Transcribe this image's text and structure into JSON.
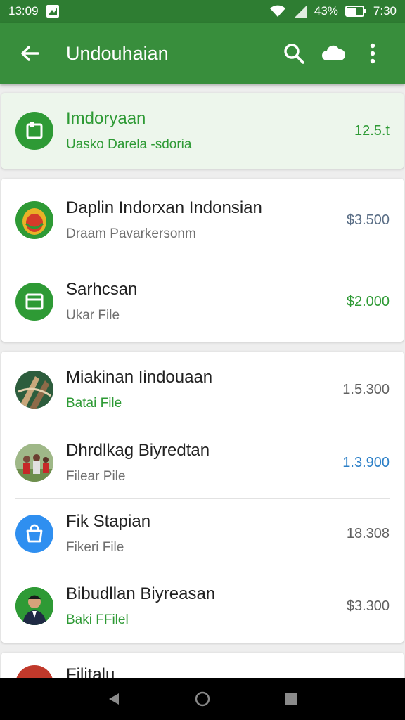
{
  "status": {
    "time_left": "13:09",
    "battery": "43%",
    "time_right": "7:30",
    "icons": [
      "image-icon",
      "wifi-icon",
      "signal-icon",
      "battery-icon"
    ]
  },
  "appbar": {
    "title": "Undouhaian",
    "icons": [
      "back-arrow-icon",
      "search-icon",
      "cloud-icon",
      "more-vert-icon"
    ]
  },
  "featured": {
    "name": "Imdoryaan",
    "subtitle": "Uasko Darela  -sdoria",
    "amount": "12.5.t",
    "icon": "document-icon"
  },
  "group1": [
    {
      "name": "Daplin Indorxan Indonsian",
      "subtitle": "Draam Pavarkersonm",
      "amount": "$3.500",
      "icon": "flag-emblem-icon"
    },
    {
      "name": "Sarhcsan",
      "subtitle": "Ukar File",
      "amount": "$2.000",
      "icon": "window-icon"
    }
  ],
  "group2": [
    {
      "name": "Miakinan Iindouaan",
      "subtitle": "Batai File",
      "amount": "1.5.300",
      "icon": "artwork-thumbnail"
    },
    {
      "name": "Dhrdlkag Biyredtan",
      "subtitle": "Filear Pile",
      "amount": "1.3.900",
      "icon": "people-photo-thumbnail"
    },
    {
      "name": "Fik Stapian",
      "subtitle": "Fikeri File",
      "amount": "18.308",
      "icon": "shopping-bag-icon"
    },
    {
      "name": "Bibudllan Biyreasan",
      "subtitle": "Baki FFilel",
      "amount": "$3.300",
      "icon": "person-portrait-thumbnail"
    }
  ],
  "partial": {
    "name": "Filitalu",
    "icon": "partial-avatar"
  },
  "navbar": {
    "icons": [
      "back-triangle-icon",
      "home-circle-icon",
      "recents-square-icon"
    ]
  },
  "colors": {
    "appbar": "#388e3c",
    "statusbar": "#2e7d32",
    "accent_green": "#2e9a35",
    "accent_blue": "#2b7fc7"
  }
}
